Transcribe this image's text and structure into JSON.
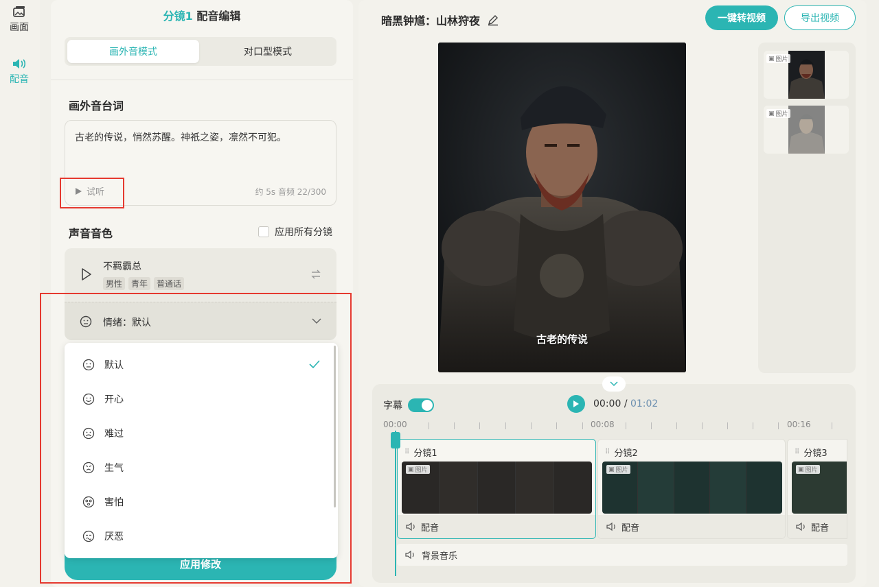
{
  "rail": {
    "items": [
      {
        "label": "画面",
        "icon": "image-icon",
        "active": false
      },
      {
        "label": "配音",
        "icon": "speaker-icon",
        "active": true
      }
    ]
  },
  "editor": {
    "title_prefix": "分镜1",
    "title": "配音编辑",
    "modes": [
      "画外音模式",
      "对口型模式"
    ],
    "active_mode": "画外音模式",
    "script_section": "画外音台词",
    "script_text": "古老的传说，悄然苏醒。神祇之姿，凛然不可犯。",
    "preview_label": "试听",
    "counter": "约 5s 音频 22/300",
    "voice_section": "声音音色",
    "apply_all_label": "应用所有分镜",
    "voice": {
      "name": "不羁霸总",
      "tags": [
        "男性",
        "青年",
        "普通话"
      ]
    },
    "emotion_label": "情绪：默认",
    "emotions": [
      {
        "label": "默认",
        "icon": "neutral-face-icon",
        "selected": true
      },
      {
        "label": "开心",
        "icon": "happy-face-icon",
        "selected": false
      },
      {
        "label": "难过",
        "icon": "sad-face-icon",
        "selected": false
      },
      {
        "label": "生气",
        "icon": "angry-face-icon",
        "selected": false
      },
      {
        "label": "害怕",
        "icon": "scared-face-icon",
        "selected": false
      },
      {
        "label": "厌恶",
        "icon": "disgust-face-icon",
        "selected": false
      }
    ],
    "apply_button": "应用修改"
  },
  "project": {
    "title": "暗黑钟馗：山林狩夜",
    "convert_button": "一键转视频",
    "export_button": "导出视频",
    "subtitle_overlay": "古老的传说",
    "image_tag": "图片"
  },
  "timeline": {
    "subtitle_label": "字幕",
    "current_time": "00:00",
    "separator": "/",
    "total_time": "01:02",
    "ruler_labels": [
      "00:00",
      "00:08",
      "00:16"
    ],
    "clips": [
      {
        "label": "分镜1",
        "dub": "配音"
      },
      {
        "label": "分镜2",
        "dub": "配音"
      },
      {
        "label": "分镜3",
        "dub": "配音"
      }
    ],
    "bgm_label": "背景音乐"
  },
  "colors": {
    "accent": "#2bb5b3",
    "highlight": "#e5392f",
    "background": "#f1f0ea"
  }
}
